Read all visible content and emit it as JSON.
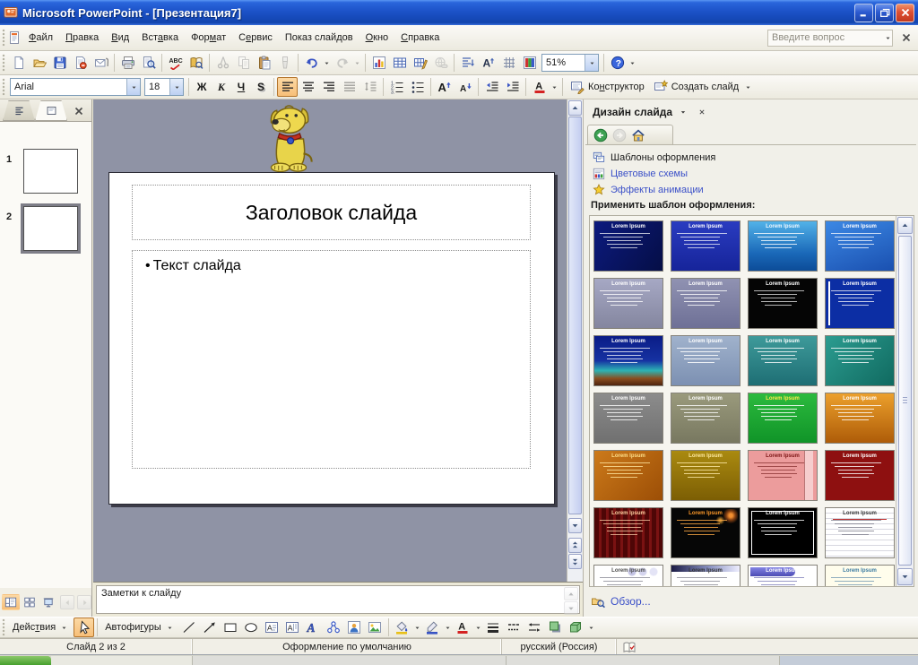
{
  "window": {
    "title": "Microsoft PowerPoint - [Презентация7]"
  },
  "menu": {
    "items": [
      {
        "label": "Файл",
        "u": 0
      },
      {
        "label": "Правка",
        "u": 0
      },
      {
        "label": "Вид",
        "u": 0
      },
      {
        "label": "Вставка",
        "u": 3
      },
      {
        "label": "Формат",
        "u": 3
      },
      {
        "label": "Сервис",
        "u": 1
      },
      {
        "label": "Показ слайдов",
        "u": 10
      },
      {
        "label": "Окно",
        "u": 0
      },
      {
        "label": "Справка",
        "u": 0
      }
    ],
    "question_placeholder": "Введите вопрос"
  },
  "standard_toolbar": {
    "zoom_value": "51%"
  },
  "formatting_toolbar": {
    "font_name": "Arial",
    "font_size": "18",
    "bold": "Ж",
    "italic": "К",
    "underline": "Ч",
    "shadow": "S",
    "design": {
      "label": "Конструктор",
      "u": 2
    },
    "new_slide": {
      "label": "Создать слайд",
      "u": 12
    }
  },
  "slides_panel": {
    "slides": [
      {
        "number": "1"
      },
      {
        "number": "2"
      }
    ],
    "selected_number": "2"
  },
  "slide": {
    "title": "Заголовок слайда",
    "bullet_marker": "•",
    "bullet_text": "Текст слайда"
  },
  "notes": {
    "placeholder": "Заметки к слайду"
  },
  "task_pane": {
    "title": "Дизайн слайда",
    "links": [
      {
        "label": "Шаблоны оформления",
        "current": true
      },
      {
        "label": "Цветовые схемы",
        "current": false
      },
      {
        "label": "Эффекты анимации",
        "current": false
      }
    ],
    "apply_label": "Применить шаблон оформления:",
    "browse_label": "Обзор...",
    "template_title": "Lorem Ipsum",
    "templates": [
      {
        "bg": "linear-gradient(125deg,#0c1a7e 0%,#050e46 100%)",
        "fg": "#ffffff",
        "ln": "rgba(255,255,255,.72)",
        "accent": "none"
      },
      {
        "bg": "linear-gradient(180deg,#2a3cc0,#16249a)",
        "fg": "#ffffff",
        "ln": "rgba(255,255,255,.72)",
        "accent": "none"
      },
      {
        "bg": "linear-gradient(180deg,#52b2e8 0%,#1a68b8 65%,#0c4c98 100%)",
        "fg": "#f0f8ff",
        "ln": "rgba(255,255,255,.8)",
        "accent": "none"
      },
      {
        "bg": "linear-gradient(160deg,#3c88e4 0%,#1a50b0 100%)",
        "fg": "#ffffff",
        "ln": "rgba(255,255,255,.75)",
        "accent": "none"
      },
      {
        "bg": "linear-gradient(180deg,#a6a8c4,#84869f)",
        "fg": "#ffffff",
        "ln": "rgba(255,255,255,.8)",
        "accent": "none"
      },
      {
        "bg": "linear-gradient(180deg,#9092b2,#6e7096)",
        "fg": "#ffffff",
        "ln": "rgba(255,255,255,.8)",
        "accent": "none"
      },
      {
        "bg": "#050505",
        "fg": "#ffffff",
        "ln": "rgba(255,255,255,.7)",
        "accent": "none"
      },
      {
        "bg": "#0c2ea4",
        "fg": "#ffffff",
        "ln": "rgba(255,255,255,.75)",
        "accent": "bar-left"
      },
      {
        "bg": "linear-gradient(180deg,#0a1c86 0%,#1632a2 50%,#2cb4b4 70%,#8a4e20 86%,#4e2410 100%)",
        "fg": "#ffffff",
        "ln": "rgba(255,255,255,.75)",
        "accent": "none"
      },
      {
        "bg": "linear-gradient(180deg,#a0b2cc,#7c90b2)",
        "fg": "#ffffff",
        "ln": "rgba(255,255,255,.85)",
        "accent": "none"
      },
      {
        "bg": "linear-gradient(180deg,#3e9a9a,#1e6e74)",
        "fg": "#ffffff",
        "ln": "rgba(255,255,255,.8)",
        "accent": "none"
      },
      {
        "bg": "linear-gradient(135deg,#2c9c90,#106a60)",
        "fg": "#ffffff",
        "ln": "rgba(255,255,255,.8)",
        "accent": "none"
      },
      {
        "bg": "linear-gradient(180deg,#8c8c8c,#707070)",
        "fg": "#ffffff",
        "ln": "rgba(255,255,255,.8)",
        "accent": "none"
      },
      {
        "bg": "linear-gradient(180deg,#9a9a7c,#787860)",
        "fg": "#ffffff",
        "ln": "rgba(255,255,255,.8)",
        "accent": "none"
      },
      {
        "bg": "linear-gradient(180deg,#2cba3e,#109428)",
        "fg": "#ffe94a",
        "ln": "rgba(255,255,255,.85)",
        "accent": "none"
      },
      {
        "bg": "linear-gradient(180deg,#eca02c,#ae5c08)",
        "fg": "#ffffff",
        "ln": "rgba(255,255,255,.8)",
        "accent": "none"
      },
      {
        "bg": "linear-gradient(135deg,#cc7a1a,#9c4e06)",
        "fg": "#ffe08a",
        "ln": "rgba(255,230,160,.8)",
        "accent": "none"
      },
      {
        "bg": "linear-gradient(180deg,#aa8a10,#7c5e04)",
        "fg": "#ffeaa0",
        "ln": "rgba(255,235,170,.8)",
        "accent": "none"
      },
      {
        "bg": "#ec9c9c",
        "fg": "#7a1212",
        "ln": "rgba(110,20,20,.6)",
        "accent": "right-col"
      },
      {
        "bg": "#8e1010",
        "fg": "#ffffff",
        "ln": "rgba(255,255,255,.8)",
        "accent": "none"
      },
      {
        "bg": "repeating-linear-gradient(90deg,#4e0606 0px,#4e0606 5px,#7a1212 5px,#7a1212 8px)",
        "fg": "#ffd2a2",
        "ln": "rgba(255,210,170,.75)",
        "accent": "none"
      },
      {
        "bg": "#060606",
        "fg": "#ff9a2a",
        "ln": "rgba(255,170,70,.8)",
        "accent": "fireworks"
      },
      {
        "bg": "#000000",
        "fg": "#ffffff",
        "ln": "rgba(255,255,255,.8)",
        "accent": "inner-border"
      },
      {
        "bg": "#ffffff",
        "fg": "#383838",
        "ln": "rgba(110,110,125,.7)",
        "accent": "lines"
      },
      {
        "bg": "#ffffff",
        "fg": "#4a4a4a",
        "ln": "rgba(110,110,125,.65)",
        "accent": "circles"
      },
      {
        "bg": "#ffffff",
        "fg": "#333333",
        "ln": "rgba(110,110,125,.65)",
        "accent": "top-bar"
      },
      {
        "bg": "#ffffff",
        "fg": "#ffffff",
        "ln": "rgba(100,100,170,.65)",
        "accent": "header-pill"
      },
      {
        "bg": "#fffdec",
        "fg": "#3a7aa0",
        "ln": "rgba(70,120,160,.6)",
        "accent": "none"
      }
    ]
  },
  "drawing_toolbar": {
    "actions": {
      "label": "Действия",
      "u": 4
    },
    "autoshapes": {
      "label": "Автофигуры",
      "u": 6
    }
  },
  "status_bar": {
    "slide_info": "Слайд 2 из 2",
    "design_info": "Оформление по умолчанию",
    "language": "русский (Россия)"
  },
  "colors": {
    "titlebar_blue": "#1c52c8",
    "close_red": "#dd4f33",
    "selection_orange": "#f7bf79",
    "editor_background": "#8f93a5",
    "link_blue": "#3b50c8",
    "taskpane_background": "#f1f0e9"
  }
}
